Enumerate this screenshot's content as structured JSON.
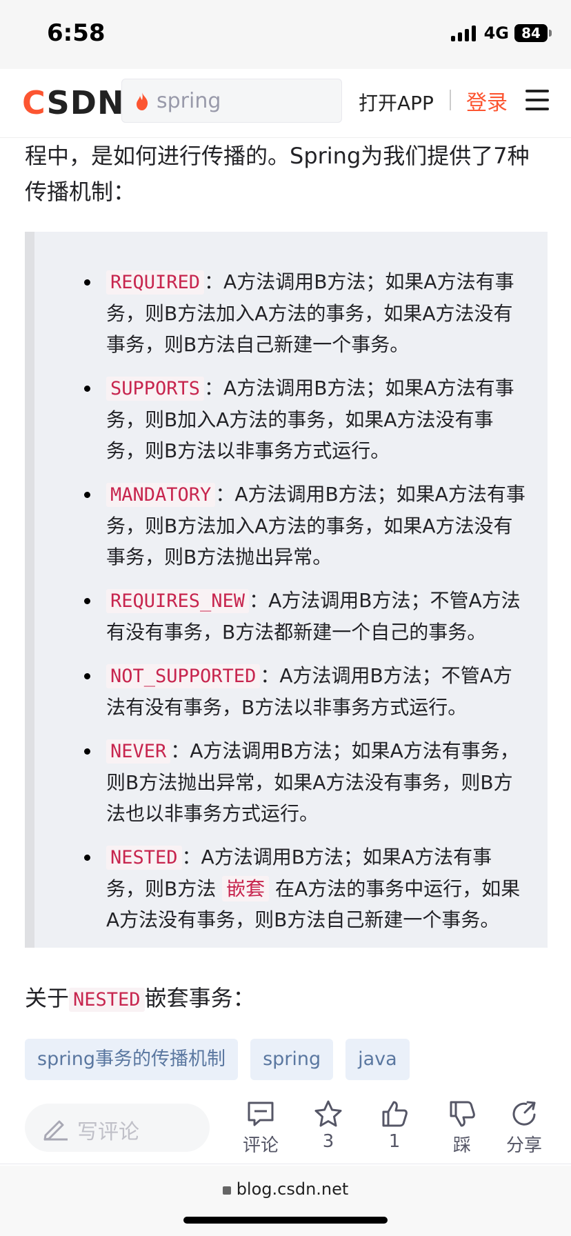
{
  "status_bar": {
    "time": "6:58",
    "network": "4G",
    "battery": "84"
  },
  "header": {
    "logo": "CSDN",
    "search_placeholder": "spring",
    "open_app": "打开APP",
    "login": "登录"
  },
  "article": {
    "lead": "程中，是如何进行传播的。Spring为我们提供了7种传播机制：",
    "items": [
      {
        "code": "REQUIRED",
        "text": "：A方法调用B方法；如果A方法有事务，则B方法加入A方法的事务，如果A方法没有事务，则B方法自己新建一个事务。"
      },
      {
        "code": "SUPPORTS",
        "text": "：A方法调用B方法；如果A方法有事务，则B加入A方法的事务，如果A方法没有事务，则B方法以非事务方式运行。"
      },
      {
        "code": "MANDATORY",
        "text": "：A方法调用B方法；如果A方法有事务，则B方法加入A方法的事务，如果A方法没有事务，则B方法抛出异常。"
      },
      {
        "code": "REQUIRES_NEW",
        "text": "：A方法调用B方法；不管A方法有没有事务，B方法都新建一个自己的事务。"
      },
      {
        "code": "NOT_SUPPORTED",
        "text": "：A方法调用B方法；不管A方法有没有事务，B方法以非事务方式运行。"
      },
      {
        "code": "NEVER",
        "text": "：A方法调用B方法；如果A方法有事务，则B方法抛出异常，如果A方法没有事务，则B方法也以非事务方式运行。"
      },
      {
        "code": "NESTED",
        "text_before": "：A方法调用B方法；如果A方法有事务，则B方法 ",
        "highlight": "嵌套",
        "text_after": " 在A方法的事务中运行，如果A方法没有事务，则B方法自己新建一个事务。"
      }
    ],
    "nested_heading": {
      "prefix": "关于",
      "code": "NESTED",
      "suffix": "嵌套事务："
    }
  },
  "tags": [
    "spring事务的传播机制",
    "spring",
    "java"
  ],
  "action_bar": {
    "comment_placeholder": "写评论",
    "comment_label": "评论",
    "star_count": "3",
    "like_count": "1",
    "dislike_label": "踩",
    "share_label": "分享"
  },
  "url_bar": {
    "url": "blog.csdn.net"
  },
  "colors": {
    "brand": "#fc5531",
    "code_text": "#c7254e",
    "tag_bg": "#eaf0f9",
    "quote_bg": "#eef0f4"
  },
  "icons": [
    "flame-icon",
    "menu-icon",
    "pencil-icon",
    "comment-icon",
    "star-icon",
    "thumbs-up-icon",
    "thumbs-down-icon",
    "share-icon",
    "lock-icon"
  ]
}
